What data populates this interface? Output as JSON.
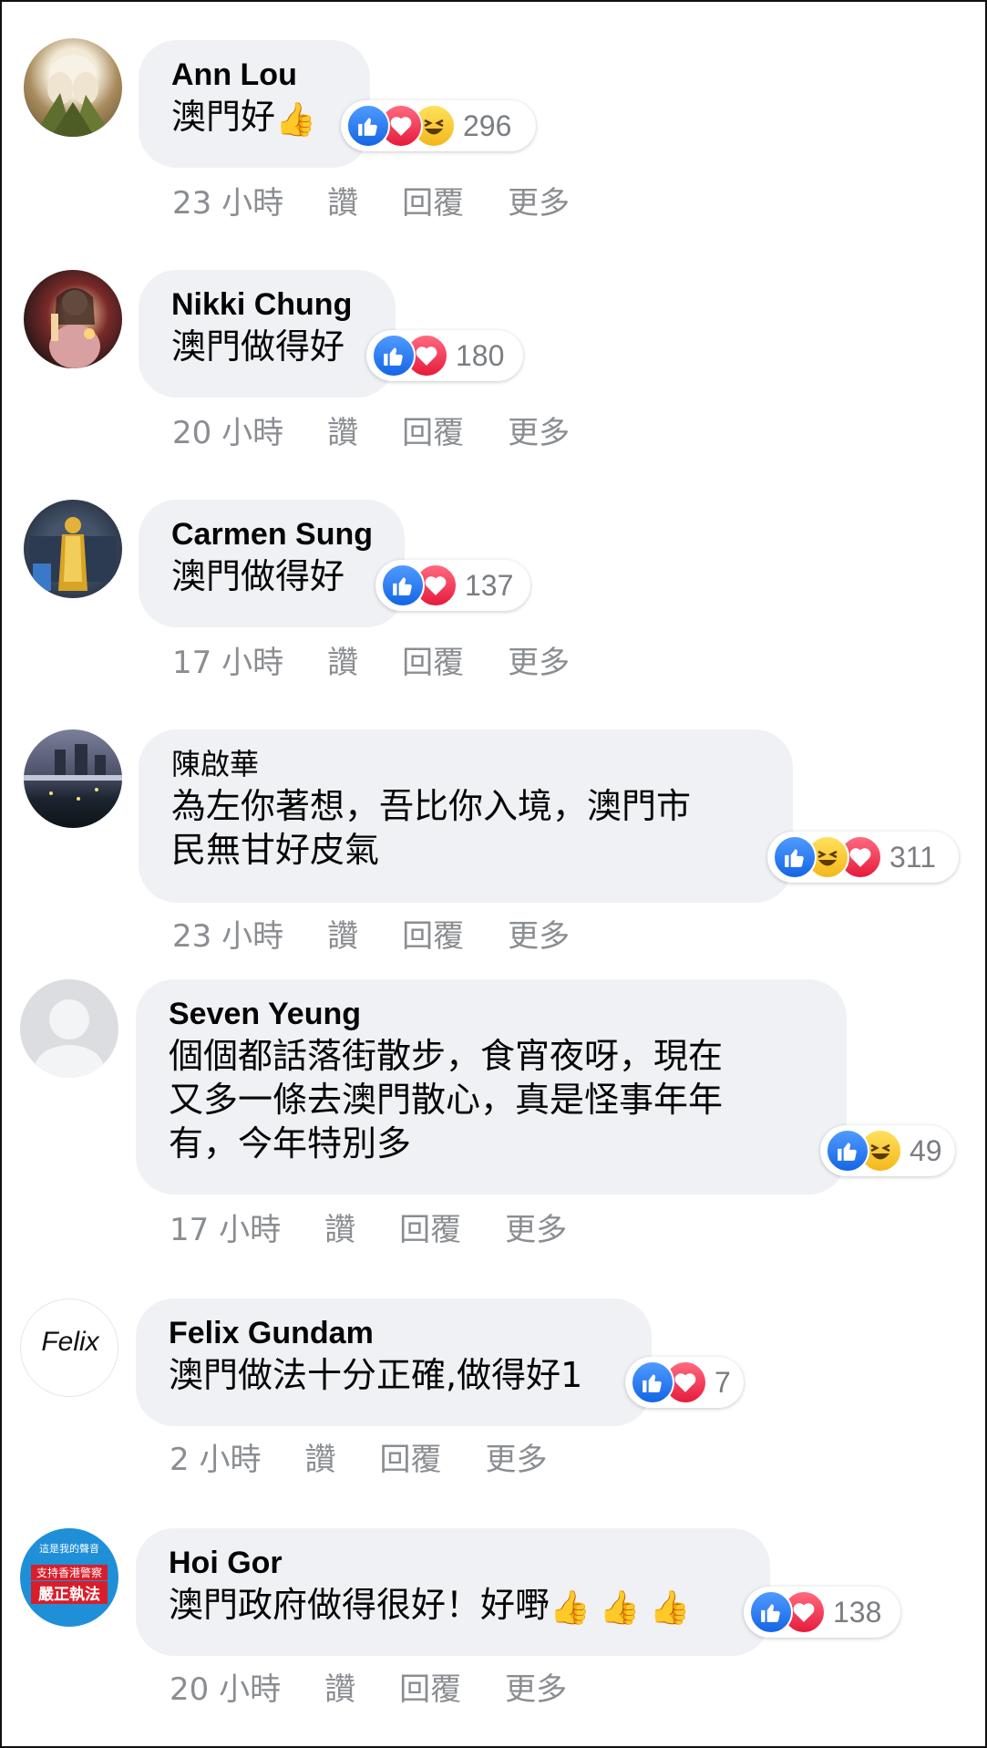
{
  "comments": [
    {
      "author": "Ann Lou",
      "text": "澳門好",
      "thumbs": 1,
      "count": "296",
      "reactions": [
        "like",
        "love",
        "haha"
      ],
      "time": "23 小時",
      "like": "讚",
      "reply": "回覆",
      "more": "更多"
    },
    {
      "author": "Nikki Chung",
      "text": "澳門做得好",
      "thumbs": 0,
      "count": "180",
      "reactions": [
        "like",
        "love"
      ],
      "time": "20 小時",
      "like": "讚",
      "reply": "回覆",
      "more": "更多"
    },
    {
      "author": "Carmen Sung",
      "text": "澳門做得好",
      "thumbs": 0,
      "count": "137",
      "reactions": [
        "like",
        "love"
      ],
      "time": "17 小時",
      "like": "讚",
      "reply": "回覆",
      "more": "更多"
    },
    {
      "author": "陳啟華",
      "text": "為左你著想，吾比你入境，澳門市\n民無甘好皮氣",
      "thumbs": 0,
      "count": "311",
      "reactions": [
        "like",
        "haha",
        "love"
      ],
      "time": "23 小時",
      "like": "讚",
      "reply": "回覆",
      "more": "更多"
    },
    {
      "author": "Seven Yeung",
      "text": "個個都話落街散步，食宵夜呀，現在\n又多一條去澳門散心，真是怪事年年\n有，今年特別多",
      "thumbs": 0,
      "count": "49",
      "reactions": [
        "like",
        "haha"
      ],
      "time": "17 小時",
      "like": "讚",
      "reply": "回覆",
      "more": "更多"
    },
    {
      "author": "Felix Gundam",
      "text": "澳門做法十分正確,做得好1",
      "thumbs": 0,
      "count": "7",
      "reactions": [
        "like",
        "love"
      ],
      "time": "2 小時",
      "like": "讚",
      "reply": "回覆",
      "more": "更多"
    },
    {
      "author": "Hoi Gor",
      "text": "澳門政府做得很好！好嘢",
      "thumbs": 3,
      "count": "138",
      "reactions": [
        "like",
        "love"
      ],
      "time": "20 小時",
      "like": "讚",
      "reply": "回覆",
      "more": "更多"
    }
  ],
  "avatar_logos": {
    "felix": "Felix",
    "hoigor_top": "這是我的聲音",
    "hoigor_mid": "支持香港警察",
    "hoigor_bot": "嚴正執法"
  }
}
